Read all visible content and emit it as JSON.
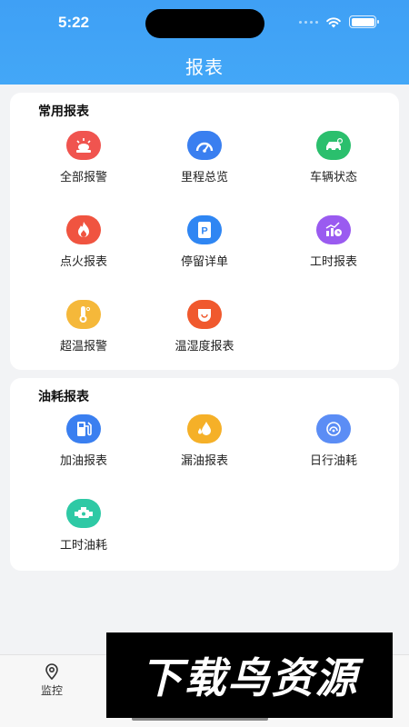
{
  "status_bar": {
    "time": "5:22"
  },
  "header": {
    "title": "报表"
  },
  "sections": [
    {
      "title": "常用报表",
      "items": [
        {
          "label": "全部报警",
          "icon": "alarm-light-icon",
          "color": "#f0544f"
        },
        {
          "label": "里程总览",
          "icon": "speedometer-icon",
          "color": "#3a7ff0"
        },
        {
          "label": "车辆状态",
          "icon": "car-status-icon",
          "color": "#2bbf6d"
        },
        {
          "label": "点火报表",
          "icon": "flame-icon",
          "color": "#f05440"
        },
        {
          "label": "停留详单",
          "icon": "parking-icon",
          "color": "#2f86f3"
        },
        {
          "label": "工时报表",
          "icon": "chart-clock-icon",
          "color": "#9a5bf0"
        },
        {
          "label": "超温报警",
          "icon": "thermometer-icon",
          "color": "#f5b83a"
        },
        {
          "label": "温湿度报表",
          "icon": "humidity-icon",
          "color": "#f0592e"
        }
      ]
    },
    {
      "title": "油耗报表",
      "items": [
        {
          "label": "加油报表",
          "icon": "fuel-pump-icon",
          "color": "#3a7ff0"
        },
        {
          "label": "漏油报表",
          "icon": "oil-drop-icon",
          "color": "#f5b028"
        },
        {
          "label": "日行油耗",
          "icon": "daily-gauge-icon",
          "color": "#5b8df5"
        },
        {
          "label": "工时油耗",
          "icon": "engine-icon",
          "color": "#2ec9a5"
        }
      ]
    }
  ],
  "tabbar": {
    "items": [
      {
        "label": "监控",
        "icon": "location-pin-icon"
      }
    ]
  },
  "watermark": {
    "text": "下载鸟资源"
  }
}
